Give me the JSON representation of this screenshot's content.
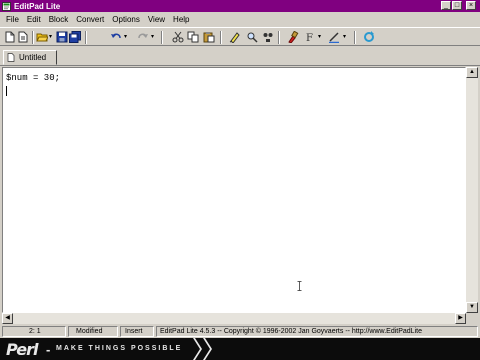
{
  "window": {
    "title": "EditPad Lite",
    "controls": {
      "minimize": "_",
      "maximize": "□",
      "close": "×"
    }
  },
  "menu": [
    "File",
    "Edit",
    "Block",
    "Convert",
    "Options",
    "View",
    "Help"
  ],
  "toolbar": {
    "icons": [
      "new-file-icon",
      "open-folder-icon",
      "save-icon",
      "save-all-icon",
      "undo-icon",
      "redo-icon",
      "cut-icon",
      "copy-icon",
      "paste-icon",
      "highlight-icon",
      "search-icon",
      "replace-icon",
      "paint-icon",
      "format-icon",
      "pen-icon",
      "refresh-icon"
    ]
  },
  "tabs": [
    {
      "label": "Untitled",
      "active": true
    }
  ],
  "editor": {
    "lines": [
      "$num = 30;"
    ]
  },
  "status": {
    "position": "2: 1",
    "modified": "Modified",
    "mode": "Insert",
    "info": "EditPad Lite 4.5.3  --  Copyright © 1996-2002  Jan Goyvaerts  --  http://www.EditPadLite"
  },
  "brand": {
    "logo": "Perl",
    "tagline": "MAKE THINGS POSSIBLE"
  },
  "colors": {
    "titlebar": "#800080",
    "chrome": "#d4d0c8",
    "editor_bg": "#ffffff",
    "brand_bg": "#0c0c0c"
  }
}
